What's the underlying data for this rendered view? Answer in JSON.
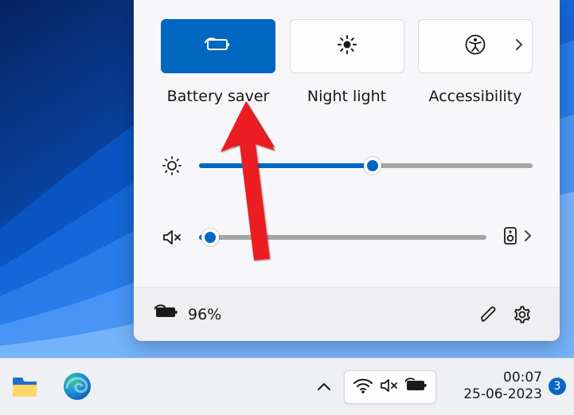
{
  "panel": {
    "tiles": [
      {
        "id": "battery-saver",
        "label": "Battery saver",
        "active": true,
        "icon": "battery-saver"
      },
      {
        "id": "night-light",
        "label": "Night light",
        "active": false,
        "icon": "night-light"
      },
      {
        "id": "accessibility",
        "label": "Accessibility",
        "active": false,
        "icon": "accessibility",
        "expand": true
      }
    ],
    "brightness_percent": 52,
    "volume_percent": 4,
    "volume_muted": true
  },
  "footer": {
    "battery_percent_label": "96%"
  },
  "taskbar": {
    "clock_time": "00:07",
    "clock_date": "25-06-2023",
    "notif_count": "3"
  }
}
